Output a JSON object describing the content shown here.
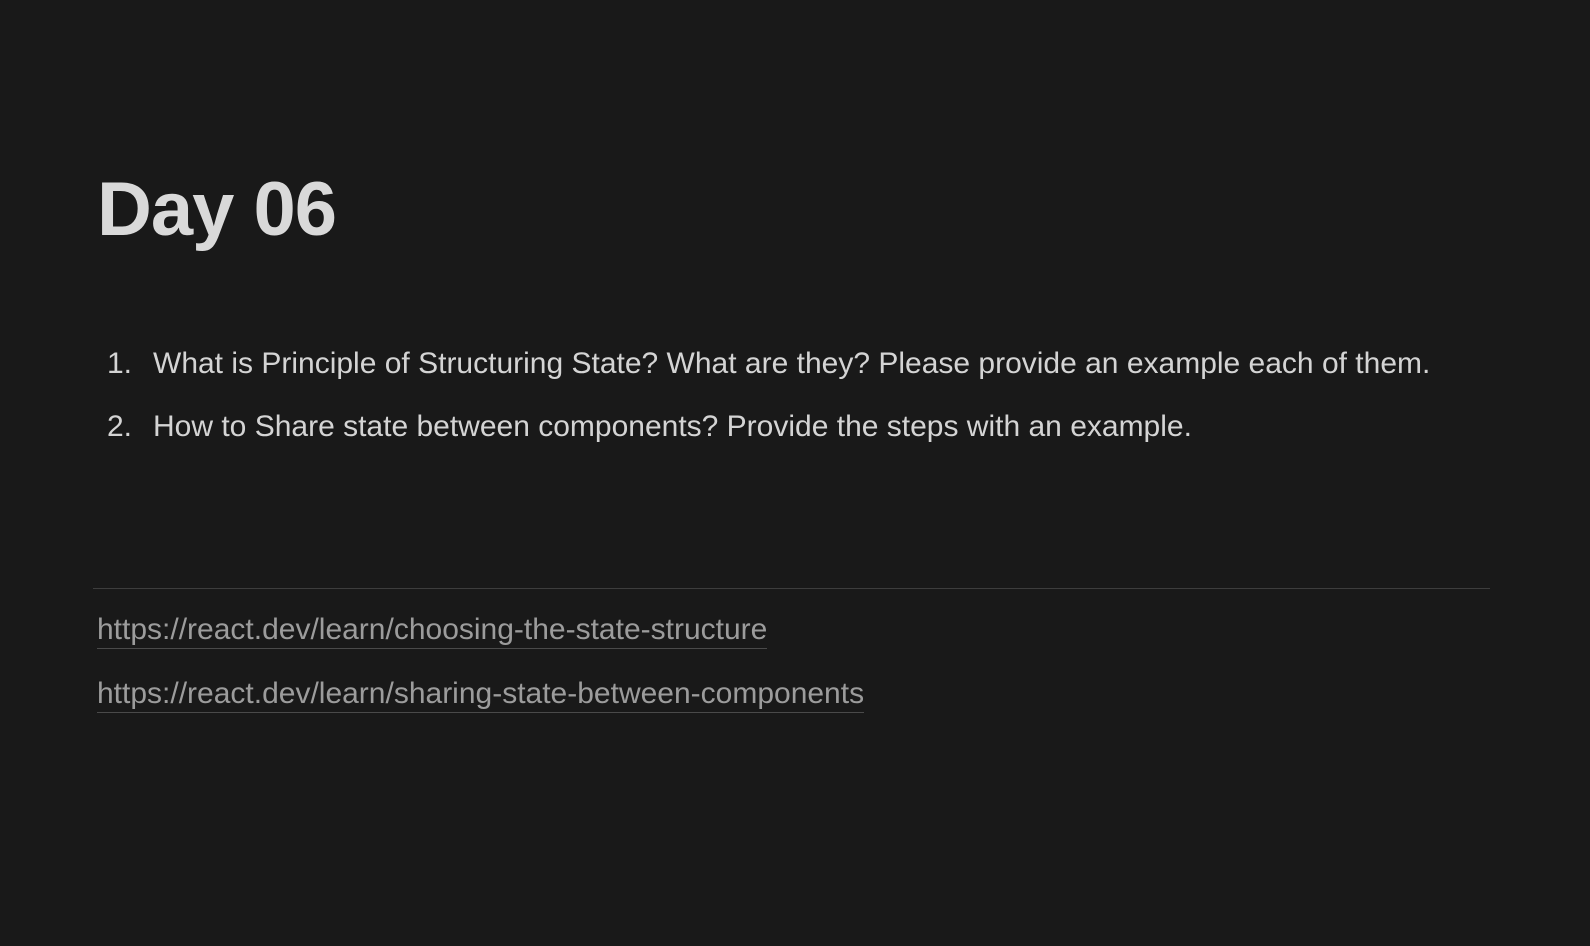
{
  "page": {
    "title": "Day 06",
    "questions": [
      {
        "number": "1.",
        "text": "What is Principle of Structuring State? What are they? Please provide an example each of them."
      },
      {
        "number": "2.",
        "text": "How to Share state between components? Provide the steps with an example."
      }
    ],
    "links": [
      "https://react.dev/learn/choosing-the-state-structure",
      "https://react.dev/learn/sharing-state-between-components"
    ]
  },
  "colors": {
    "background": "#191919",
    "text": "#d4d4d4",
    "link": "#9c9c9c"
  }
}
